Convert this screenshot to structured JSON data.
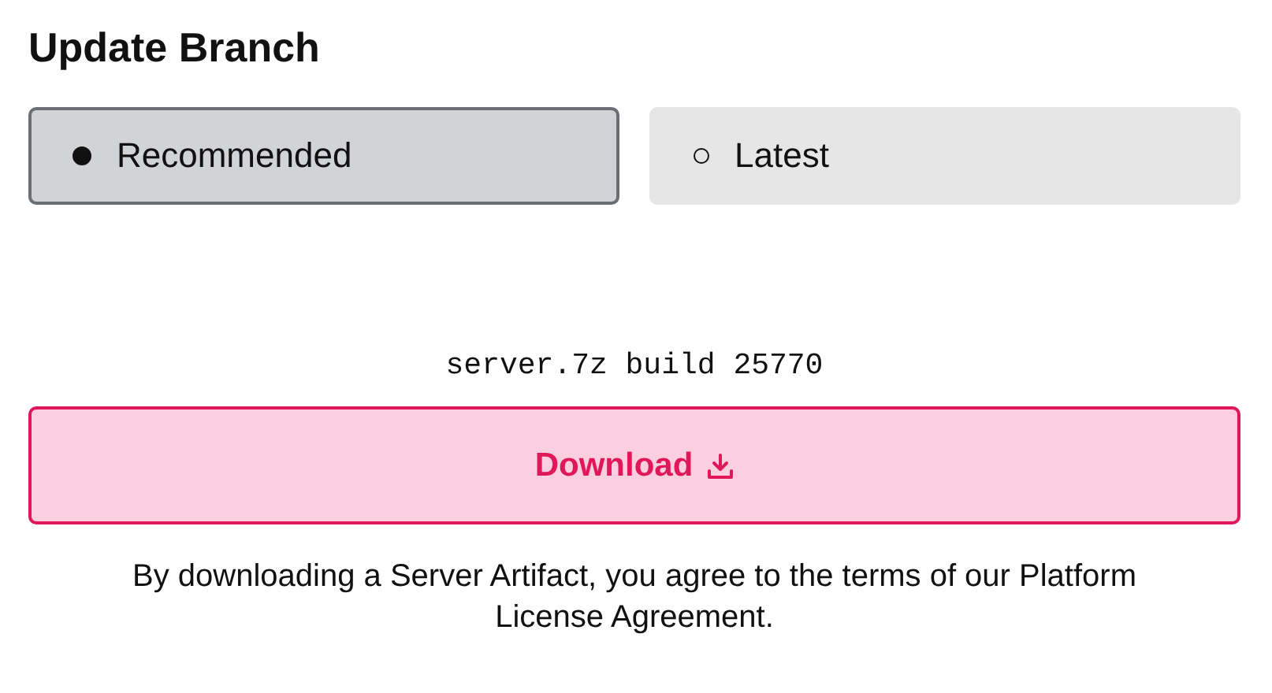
{
  "title": "Update Branch",
  "options": [
    {
      "label": "Recommended",
      "selected": true
    },
    {
      "label": "Latest",
      "selected": false
    }
  ],
  "artifact": "server.7z build 25770",
  "download_button": {
    "label": "Download"
  },
  "notice": "By downloading a Server Artifact, you agree to the terms of our Platform License Agreement."
}
